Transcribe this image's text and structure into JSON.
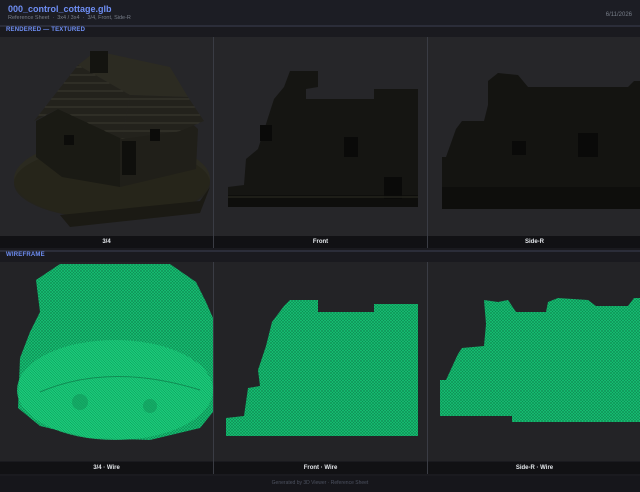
{
  "header": {
    "title": "000_control_cottage.glb",
    "subtitle": "Reference Sheet  ·  3x4 / 3x4  ·  3/4, Front, Side-R",
    "date": "6/11/2026"
  },
  "sections": {
    "rendered_label": "RENDERED — TEXTURED",
    "wireframe_label": "WIREFRAME"
  },
  "captions": {
    "rendered": [
      "3/4",
      "Front",
      "Side-R"
    ],
    "wireframe": [
      "3/4 · Wire",
      "Front · Wire",
      "Side-R · Wire"
    ]
  },
  "footer": {
    "text": "Generated by 3D Viewer · Reference Sheet"
  },
  "colors": {
    "accent": "#6f8ff5",
    "wire": "#1ed47c",
    "model_dark": "#151512"
  }
}
